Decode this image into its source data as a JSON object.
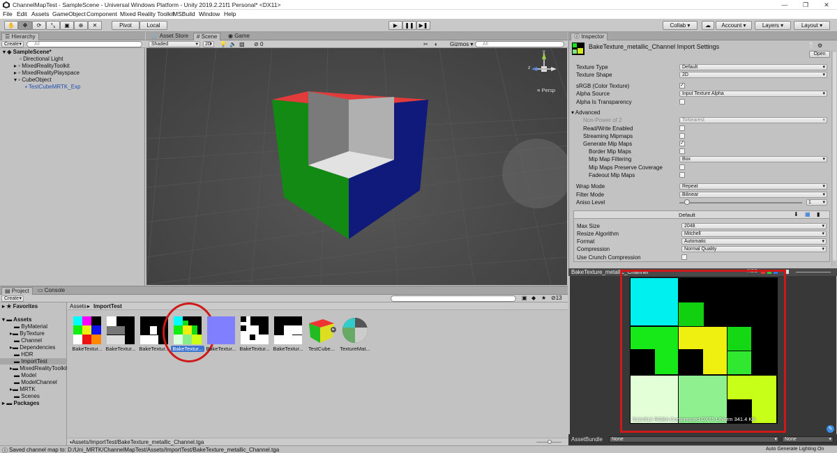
{
  "window": {
    "title": "ChannelMapTest - SampleScene - Universal Windows Platform - Unity 2019.2.21f1 Personal* <DX11>",
    "minimize": "—",
    "maximize": "❐",
    "close": "✕"
  },
  "menu": [
    "File",
    "Edit",
    "Assets",
    "GameObject",
    "Component",
    "Mixed Reality Toolkit",
    "MSBuild",
    "Window",
    "Help"
  ],
  "toolbar": {
    "pivot": "Pivot",
    "local": "Local",
    "collab": "Collab ▾",
    "account": "Account",
    "layers": "Layers",
    "layout": "Layout"
  },
  "hierarchy": {
    "tab": "Hierarchy",
    "create": "Create",
    "search_placeholder": "All",
    "items": [
      "SampleScene*",
      "Directional Light",
      "MixedRealityToolkit",
      "MixedRealityPlayspace",
      "CubeObject",
      "TestCubeMRTK_Exp"
    ]
  },
  "scene_tabs": {
    "asset_store": "Asset Store",
    "scene": "Scene",
    "game": "Game",
    "shading": "Shaded",
    "mode_2d": "2D",
    "fx_count": "0",
    "gizmos": "Gizmos",
    "search_placeholder": "All",
    "persp": "Persp",
    "axis_y": "y",
    "axis_z": "z"
  },
  "inspector": {
    "tab": "Inspector",
    "title": "BakeTexture_metallic_Channel Import Settings",
    "open": "Open",
    "texture_type_label": "Texture Type",
    "texture_type": "Default",
    "texture_shape_label": "Texture Shape",
    "texture_shape": "2D",
    "srgb_label": "sRGB (Color Texture)",
    "alpha_source_label": "Alpha Source",
    "alpha_source": "Input Texture Alpha",
    "alpha_transparency_label": "Alpha Is Transparency",
    "advanced_label": "Advanced",
    "npot_label": "Non-Power of 2",
    "npot": "ToNearest",
    "readwrite_label": "Read/Write Enabled",
    "streaming_label": "Streaming Mipmaps",
    "genmip_label": "Generate Mip Maps",
    "border_label": "Border Mip Maps",
    "filtering_label": "Mip Map Filtering",
    "filtering": "Box",
    "preserve_label": "Mip Maps Preserve Coverage",
    "fadeout_label": "Fadeout Mip Maps",
    "wrap_label": "Wrap Mode",
    "wrap": "Repeat",
    "filter_label": "Filter Mode",
    "filter": "Bilinear",
    "aniso_label": "Aniso Level",
    "aniso": "1",
    "aniso_level": 1,
    "platform_default": "Default",
    "maxsize_label": "Max Size",
    "maxsize": "2048",
    "resize_label": "Resize Algorithm",
    "resize": "Mitchell",
    "format_label": "Format",
    "format": "Automatic",
    "compression_label": "Compression",
    "compression": "Normal Quality",
    "crunch_label": "Use Crunch Compression",
    "checks": {
      "srgb": true,
      "alpha_transparency": false,
      "readwrite": false,
      "streaming": false,
      "genmip": true,
      "border": false,
      "preserve": false,
      "fadeout": false,
      "crunch": false
    }
  },
  "preview": {
    "title": "BakeTexture_metallic_Channel",
    "rgb": "RGB",
    "info": "512x512  RGBA Compressed DXT5 UNorm  341.4 KB",
    "assetbundle_label": "AssetBundle",
    "assetbundle": "None",
    "variant": "None",
    "highlight_color": "#d01818"
  },
  "project": {
    "tab": "Project",
    "console_tab": "Console",
    "create": "Create",
    "favorites": "Favorites",
    "assets": "Assets",
    "folders": [
      "ByMaterial",
      "ByTexture",
      "Channel",
      "Dependencies",
      "HDR",
      "ImportTest",
      "MixedRealityToolkit",
      "Model",
      "ModelChannel",
      "MRTK",
      "Scenes"
    ],
    "packages": "Packages",
    "breadcrumb_root": "Assets",
    "breadcrumb_sep": "▸",
    "breadcrumb_current": "ImportTest",
    "count": "13",
    "items": [
      "BakeTextur...",
      "BakeTextur...",
      "BakeTextur...",
      "BakeTextur...",
      "BakeTextur...",
      "BakeTextur...",
      "BakeTextur...",
      "TestCube...",
      "TextureMat..."
    ],
    "selected_path": "Assets/ImportTest/BakeTexture_metallic_Channel.tga",
    "circle_color": "#d01818"
  },
  "status": {
    "message": "Saved channel map to: D:/Uni_MRTK/ChannelMapTest/Assets/ImportTest/BakeTexture_metallic_Channel.tga",
    "lighting": "Auto Generate Lighting On"
  }
}
